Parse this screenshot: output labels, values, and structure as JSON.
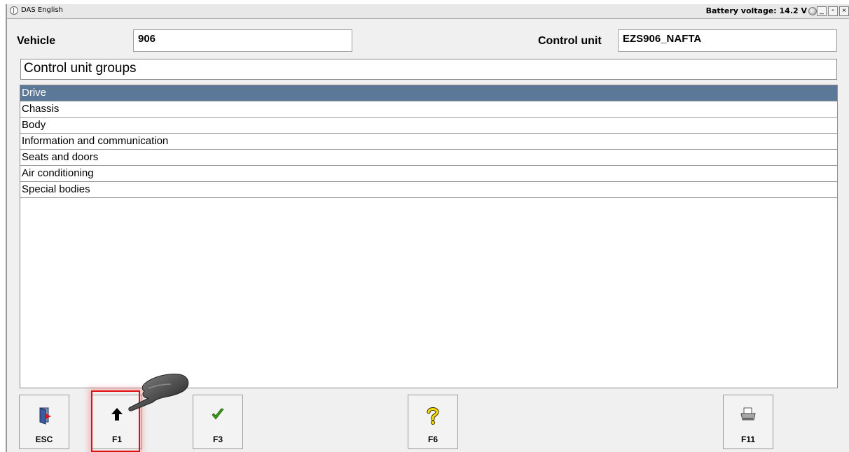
{
  "window": {
    "title": "DAS English",
    "battery_label": "Battery voltage: 14.2 V",
    "controls": {
      "minimize": "_",
      "maximize": "▫",
      "close": "×"
    }
  },
  "vehicle": {
    "label": "Vehicle",
    "value": "906"
  },
  "control_unit": {
    "label": "Control unit",
    "value": "EZS906_NAFTA"
  },
  "groups": {
    "header": "Control unit groups",
    "items": [
      {
        "label": "Drive",
        "selected": true
      },
      {
        "label": "Chassis",
        "selected": false
      },
      {
        "label": "Body",
        "selected": false
      },
      {
        "label": "Information and communication",
        "selected": false
      },
      {
        "label": "Seats and doors",
        "selected": false
      },
      {
        "label": "Air conditioning",
        "selected": false
      },
      {
        "label": "Special bodies",
        "selected": false
      }
    ]
  },
  "function_keys": [
    {
      "key": "ESC",
      "icon": "exit-door-icon"
    },
    {
      "key": "F1",
      "icon": "up-arrow-icon"
    },
    {
      "key": "F3",
      "icon": "checkmark-icon"
    },
    {
      "key": "F6",
      "icon": "help-question-icon"
    },
    {
      "key": "F11",
      "icon": "printer-icon"
    }
  ],
  "colors": {
    "selected_row": "#5b7898",
    "highlight": "#e01010",
    "check_green": "#3a9a1a",
    "help_yellow": "#f5e000"
  }
}
